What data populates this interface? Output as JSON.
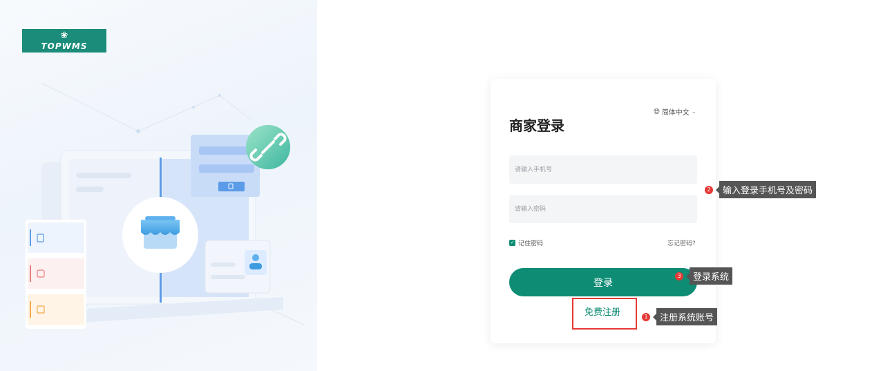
{
  "brand": {
    "logo_text": "TOPWMS"
  },
  "login": {
    "title": "商家登录",
    "language": "简体中文",
    "phone_placeholder": "请输入手机号",
    "password_placeholder": "请输入密码",
    "remember_label": "记住密码",
    "forgot_label": "忘记密码?",
    "login_button": "登录",
    "register_link": "免费注册"
  },
  "annotations": [
    {
      "num": "2",
      "text": "输入登录手机号及密码"
    },
    {
      "num": "3",
      "text": "登录系统"
    },
    {
      "num": "1",
      "text": "注册系统账号"
    }
  ],
  "colors": {
    "brand": "#0e8c74",
    "logo_bg": "#1a8c79",
    "highlight": "#e53935"
  },
  "icons": [
    "globe-icon",
    "chevron-down-icon",
    "checkbox-checked-icon",
    "link-icon",
    "store-icon"
  ]
}
